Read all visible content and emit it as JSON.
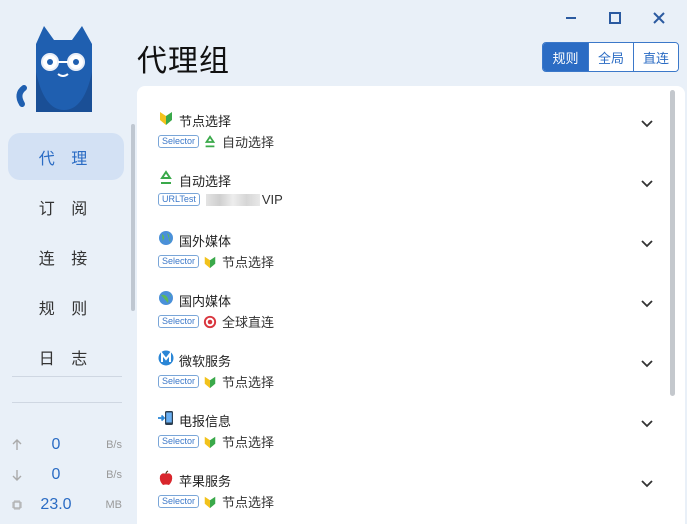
{
  "app": {
    "page_title": "代理组"
  },
  "window": {
    "controls": [
      "minimize",
      "maximize",
      "close"
    ]
  },
  "mode": {
    "buttons": [
      "规则",
      "全局",
      "直连"
    ],
    "active": "规则"
  },
  "sidebar": {
    "nav": [
      {
        "label": "代 理",
        "active": true
      },
      {
        "label": "订 阅"
      },
      {
        "label": "连 接"
      },
      {
        "label": "规 则"
      },
      {
        "label": "日 志"
      }
    ],
    "traffic": [
      {
        "icon": "upload-arrow-icon",
        "value": "0",
        "unit": "B/s"
      },
      {
        "icon": "download-arrow-icon",
        "value": "0",
        "unit": "B/s"
      },
      {
        "icon": "memory-chip-icon",
        "value": "23.0",
        "unit": "MB"
      }
    ]
  },
  "groups": [
    {
      "name": "节点选择",
      "icon": "beginner-leaf-icon",
      "type": "Selector",
      "current": "自动选择",
      "current_icon": "recycle-icon"
    },
    {
      "name": "自动选择",
      "icon": "recycle-icon",
      "type": "URLTest",
      "current": "VIP",
      "current_icon": ""
    },
    {
      "name": "国外媒体",
      "icon": "globe-icon",
      "type": "Selector",
      "current": "节点选择",
      "current_icon": "beginner-leaf-icon"
    },
    {
      "name": "国内媒体",
      "icon": "globe-icon",
      "type": "Selector",
      "current": "全球直连",
      "current_icon": "target-icon"
    },
    {
      "name": "微软服务",
      "icon": "metro-m-icon",
      "type": "Selector",
      "current": "节点选择",
      "current_icon": "beginner-leaf-icon"
    },
    {
      "name": "电报信息",
      "icon": "phone-arrow-icon",
      "type": "Selector",
      "current": "节点选择",
      "current_icon": "beginner-leaf-icon"
    },
    {
      "name": "苹果服务",
      "icon": "apple-icon",
      "type": "Selector",
      "current": "节点选择",
      "current_icon": "beginner-leaf-icon"
    }
  ],
  "colors": {
    "accent": "#2b6cc4",
    "background": "#e9f0f8",
    "nav_active": "#d3e1f4"
  }
}
